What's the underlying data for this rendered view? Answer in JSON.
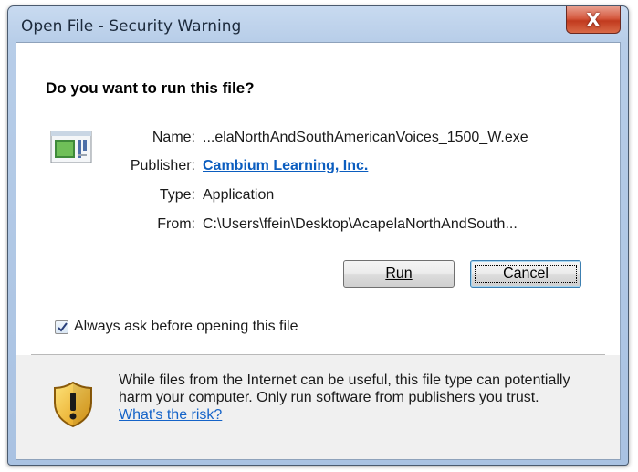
{
  "window": {
    "title": "Open File - Security Warning",
    "close_label": "X"
  },
  "dialog": {
    "heading": "Do you want to run this file?",
    "fields": {
      "name_label": "Name:",
      "name_value": "...elaNorthAndSouthAmericanVoices_1500_W.exe",
      "publisher_label": "Publisher:",
      "publisher_value": "Cambium Learning, Inc.",
      "type_label": "Type:",
      "type_value": "Application",
      "from_label": "From:",
      "from_value": "C:\\Users\\ffein\\Desktop\\AcapelaNorthAndSouth..."
    },
    "buttons": {
      "run": "Run",
      "cancel": "Cancel"
    },
    "checkbox": {
      "label": "Always ask before opening this file",
      "checked": true
    },
    "footer": {
      "warning_text": "While files from the Internet can be useful, this file type can potentially harm your computer. Only run software from publishers you trust.",
      "risk_link": "What's the risk?"
    }
  },
  "colors": {
    "link": "#0b5dbf",
    "close_button": "#c13a1e",
    "title_bar": "#b7cde8",
    "footer_bg": "#f0f0f0"
  },
  "icons": [
    "close-icon",
    "application-file-icon",
    "check-icon",
    "security-shield-icon"
  ]
}
